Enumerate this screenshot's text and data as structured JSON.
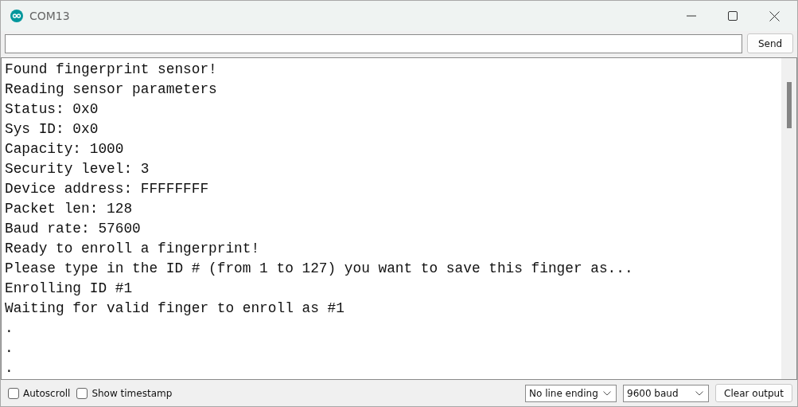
{
  "window": {
    "title": "COM13"
  },
  "send_button": "Send",
  "output_lines": [
    "Found fingerprint sensor!",
    "Reading sensor parameters",
    "Status: 0x0",
    "Sys ID: 0x0",
    "Capacity: 1000",
    "Security level: 3",
    "Device address: FFFFFFFF",
    "Packet len: 128",
    "Baud rate: 57600",
    "Ready to enroll a fingerprint!",
    "Please type in the ID # (from 1 to 127) you want to save this finger as...",
    "Enrolling ID #1",
    "Waiting for valid finger to enroll as #1",
    ".",
    ".",
    "."
  ],
  "options": [
    {
      "label": "Autoscroll",
      "checked": false
    },
    {
      "label": "Show timestamp",
      "checked": false
    }
  ],
  "line_ending": "No line ending",
  "baud": "9600 baud",
  "clear_button": "Clear output"
}
